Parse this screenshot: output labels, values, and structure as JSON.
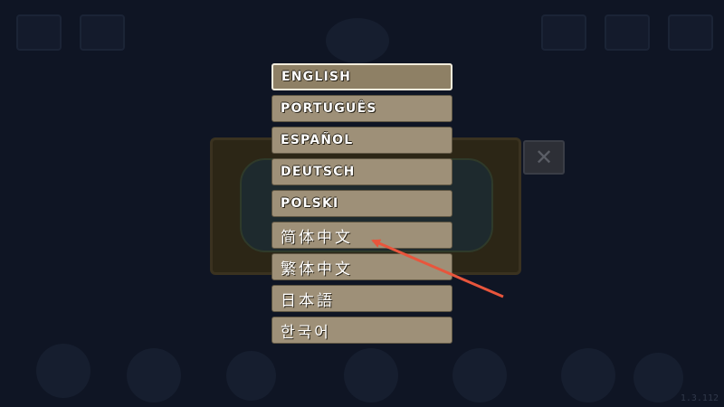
{
  "background": {
    "close_symbol": "✕",
    "version": "1.3.112"
  },
  "languages": [
    {
      "label": "English",
      "selected": true,
      "script": "latin"
    },
    {
      "label": "Português",
      "selected": false,
      "script": "latin"
    },
    {
      "label": "Español",
      "selected": false,
      "script": "latin"
    },
    {
      "label": "Deutsch",
      "selected": false,
      "script": "latin"
    },
    {
      "label": "Polski",
      "selected": false,
      "script": "latin"
    },
    {
      "label": "简体中文",
      "selected": false,
      "script": "cjk"
    },
    {
      "label": "繁体中文",
      "selected": false,
      "script": "cjk"
    },
    {
      "label": "日本語",
      "selected": false,
      "script": "cjk"
    },
    {
      "label": "한국어",
      "selected": false,
      "script": "cjk"
    }
  ],
  "annotation": {
    "color": "#e8553c",
    "points_to": "简体中文"
  }
}
